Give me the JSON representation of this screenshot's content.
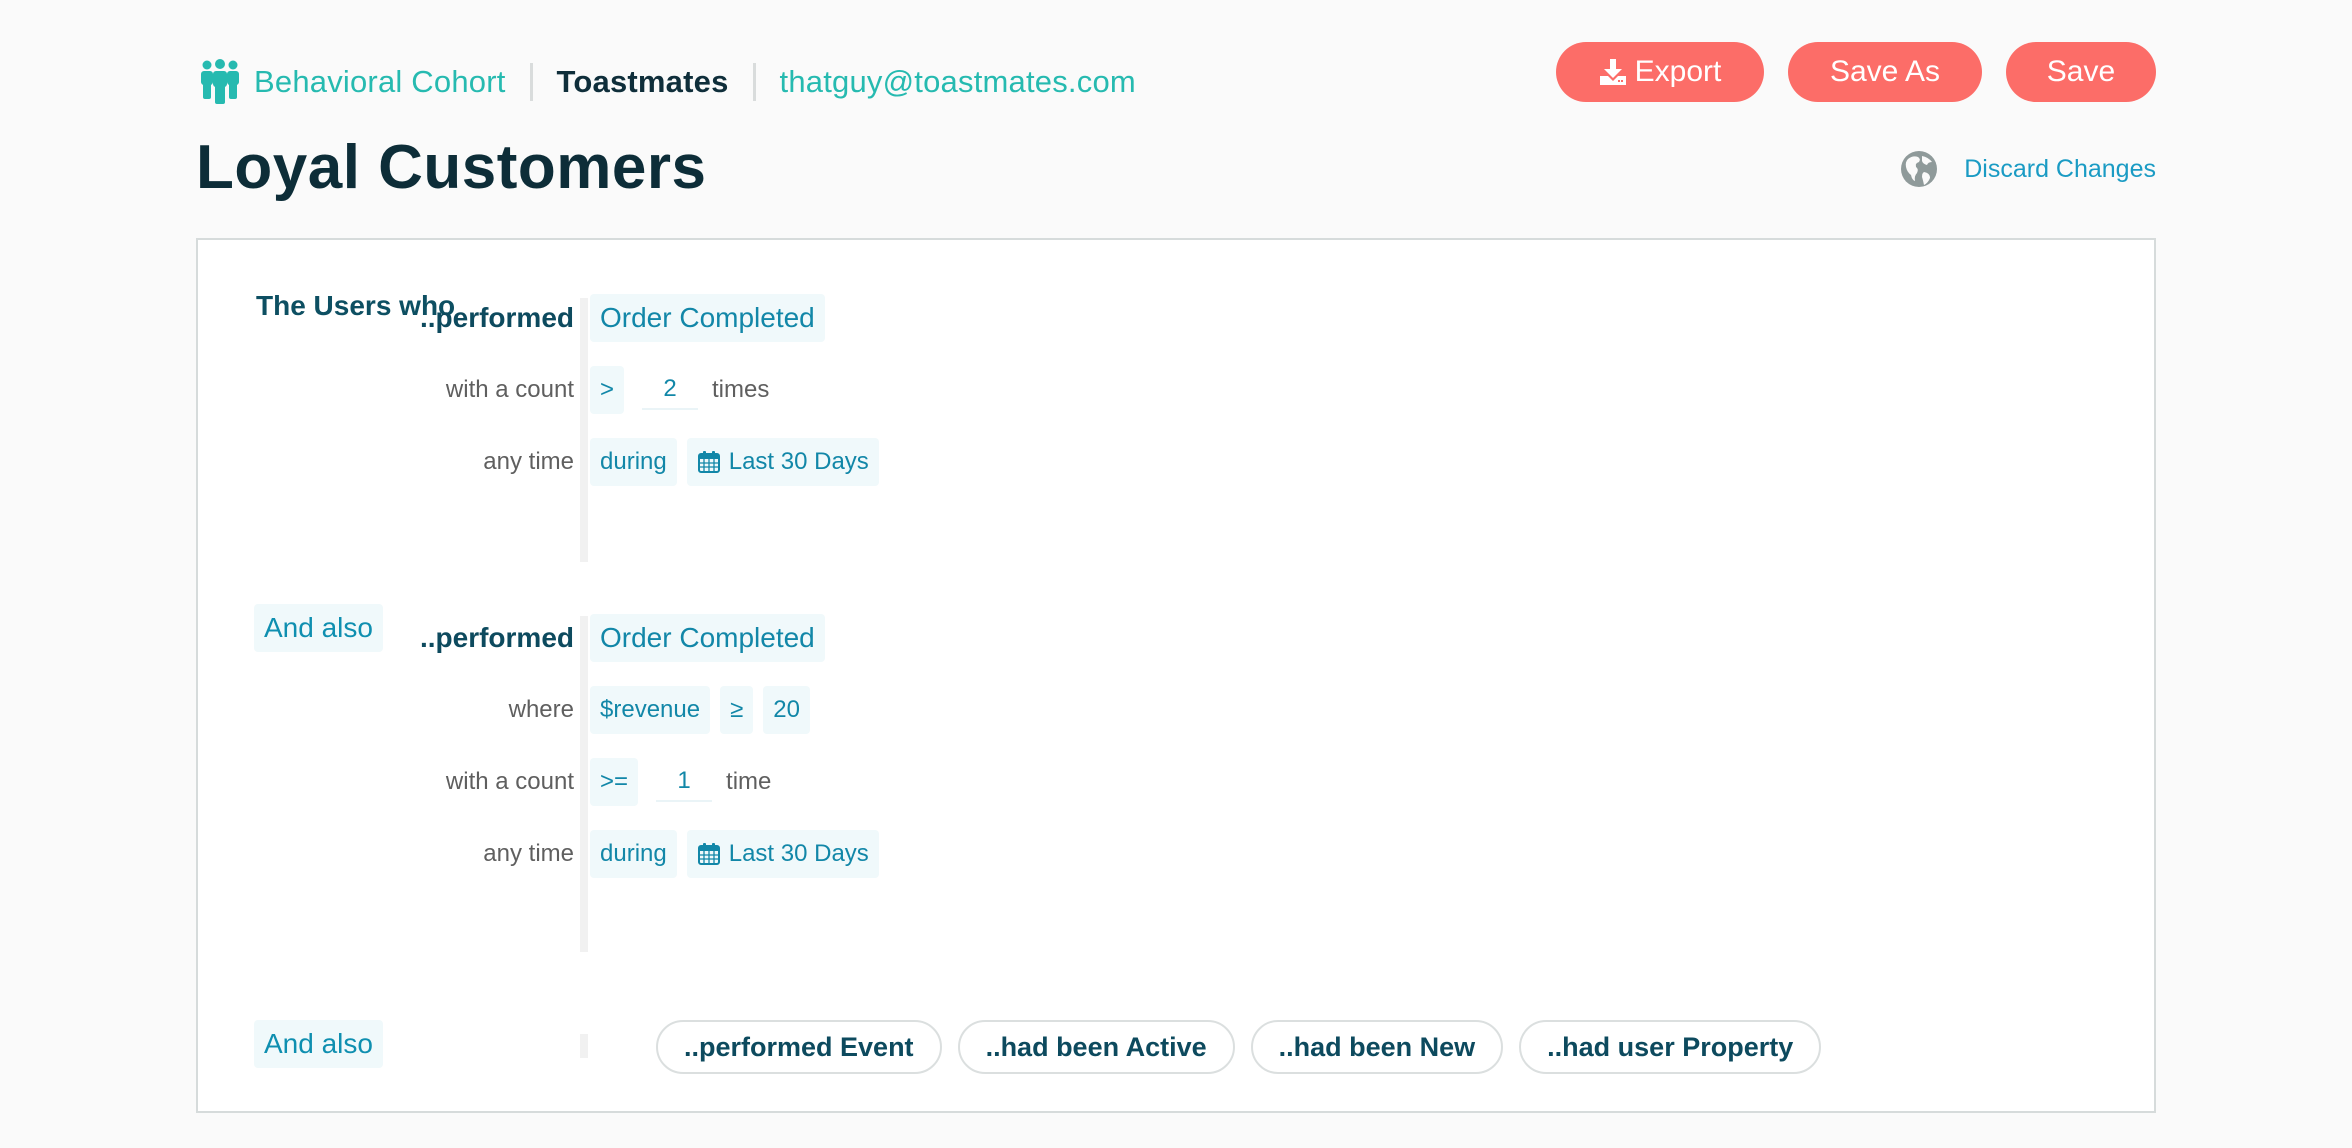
{
  "header": {
    "cohort_type": "Behavioral Cohort",
    "organization": "Toastmates",
    "user_email": "thatguy@toastmates.com",
    "icons": {
      "cohort": "people-group-icon",
      "export": "download-icon",
      "globe": "globe-icon",
      "calendar": "calendar-icon"
    }
  },
  "page": {
    "title": "Loyal Customers"
  },
  "actions": {
    "export_label": "Export",
    "save_as_label": "Save As",
    "save_label": "Save",
    "discard_label": "Discard Changes"
  },
  "colors": {
    "accent_teal": "#26bab0",
    "button_coral": "#fc6d68",
    "link_blue": "#1a9bc4",
    "chip_bg": "#f0f9fb",
    "chip_text": "#1287a8",
    "dark_text": "#0d2d38"
  },
  "criteria": {
    "intro_label": "The Users who",
    "and_also_label": "And also",
    "blocks": [
      {
        "verb": "..performed",
        "event": "Order Completed",
        "count_label": "with a count",
        "count_operator": ">",
        "count_value": "2",
        "count_unit": "times",
        "time_label": "any time",
        "time_operator": "during",
        "time_range": "Last 30 Days"
      },
      {
        "verb": "..performed",
        "event": "Order Completed",
        "where_label": "where",
        "property": "$revenue",
        "property_operator": "≥",
        "property_value": "20",
        "count_label": "with a count",
        "count_operator": ">=",
        "count_value": "1",
        "count_unit": "time",
        "time_label": "any time",
        "time_operator": "during",
        "time_range": "Last 30 Days"
      }
    ],
    "add_options": [
      "..performed Event",
      "..had been Active",
      "..had been New",
      "..had user Property"
    ]
  }
}
